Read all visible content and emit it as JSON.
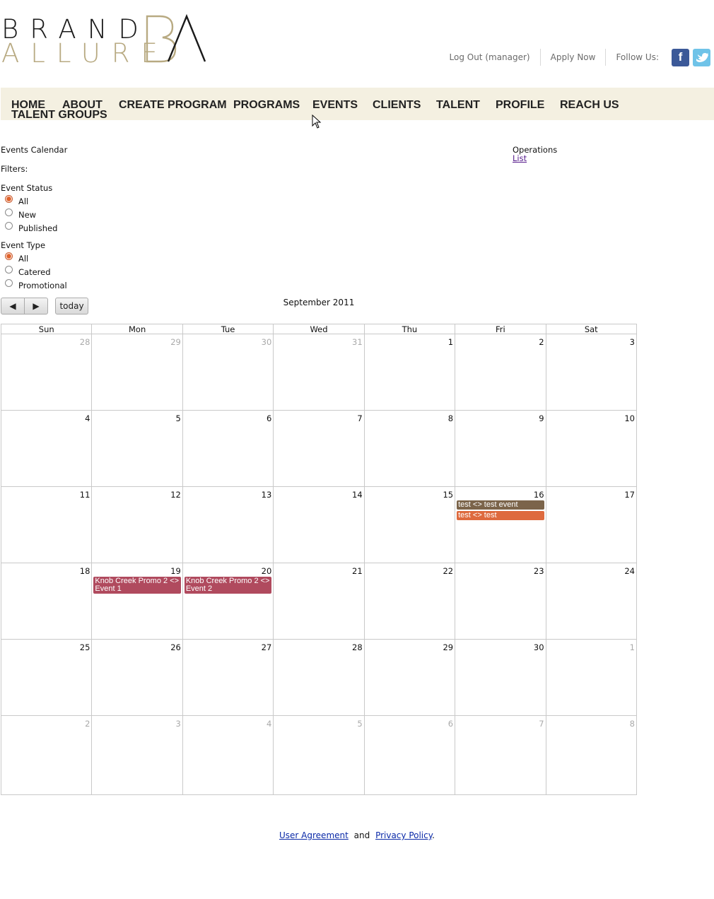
{
  "brand": {
    "word1": "BRAND",
    "word2": "ALLURE",
    "monogram": "BA",
    "gold": "#b8aa82"
  },
  "toplinks": {
    "logout": "Log Out (manager)",
    "apply": "Apply Now",
    "follow": "Follow Us:",
    "facebook_icon": "facebook-icon",
    "twitter_icon": "twitter-icon"
  },
  "nav": [
    "HOME",
    "ABOUT",
    "CREATE PROGRAM",
    "PROGRAMS",
    "EVENTS",
    "CLIENTS",
    "TALENT",
    "PROFILE",
    "REACH US",
    "TALENT GROUPS"
  ],
  "page": {
    "title": "Events Calendar",
    "filters": "Filters:",
    "operations": "Operations",
    "list_link": "List"
  },
  "filters": {
    "status": {
      "label": "Event Status",
      "options": [
        "All",
        "New",
        "Published"
      ],
      "selected": "All"
    },
    "type": {
      "label": "Event Type",
      "options": [
        "All",
        "Catered",
        "Promotional"
      ],
      "selected": "All"
    }
  },
  "calendar": {
    "title": "September 2011",
    "prev": "◀",
    "next": "▶",
    "today": "today",
    "days": [
      "Sun",
      "Mon",
      "Tue",
      "Wed",
      "Thu",
      "Fri",
      "Sat"
    ],
    "weeks": [
      [
        {
          "d": "28",
          "o": true
        },
        {
          "d": "29",
          "o": true
        },
        {
          "d": "30",
          "o": true
        },
        {
          "d": "31",
          "o": true
        },
        {
          "d": "1"
        },
        {
          "d": "2"
        },
        {
          "d": "3"
        }
      ],
      [
        {
          "d": "4"
        },
        {
          "d": "5"
        },
        {
          "d": "6"
        },
        {
          "d": "7"
        },
        {
          "d": "8"
        },
        {
          "d": "9"
        },
        {
          "d": "10"
        }
      ],
      [
        {
          "d": "11"
        },
        {
          "d": "12"
        },
        {
          "d": "13"
        },
        {
          "d": "14"
        },
        {
          "d": "15"
        },
        {
          "d": "16",
          "ev": [
            {
              "t": "test <> test event",
              "c": "#7b644a"
            },
            {
              "t": "test <> test",
              "c": "#de6a3e"
            }
          ]
        },
        {
          "d": "17"
        }
      ],
      [
        {
          "d": "18"
        },
        {
          "d": "19",
          "ev": [
            {
              "t": "Knob Creek Promo 2 <> Event 1",
              "c": "#b04a5e"
            }
          ]
        },
        {
          "d": "20",
          "ev": [
            {
              "t": "Knob Creek Promo 2 <> Event 2",
              "c": "#b04a5e"
            }
          ]
        },
        {
          "d": "21"
        },
        {
          "d": "22"
        },
        {
          "d": "23"
        },
        {
          "d": "24"
        }
      ],
      [
        {
          "d": "25"
        },
        {
          "d": "26"
        },
        {
          "d": "27"
        },
        {
          "d": "28"
        },
        {
          "d": "29"
        },
        {
          "d": "30"
        },
        {
          "d": "1",
          "o": true
        }
      ],
      [
        {
          "d": "2",
          "o": true
        },
        {
          "d": "3",
          "o": true
        },
        {
          "d": "4",
          "o": true
        },
        {
          "d": "5",
          "o": true
        },
        {
          "d": "6",
          "o": true
        },
        {
          "d": "7",
          "o": true
        },
        {
          "d": "8",
          "o": true
        }
      ]
    ]
  },
  "footer": {
    "agreement": "User Agreement",
    "and": "and",
    "privacy": "Privacy Policy",
    "end": "."
  }
}
